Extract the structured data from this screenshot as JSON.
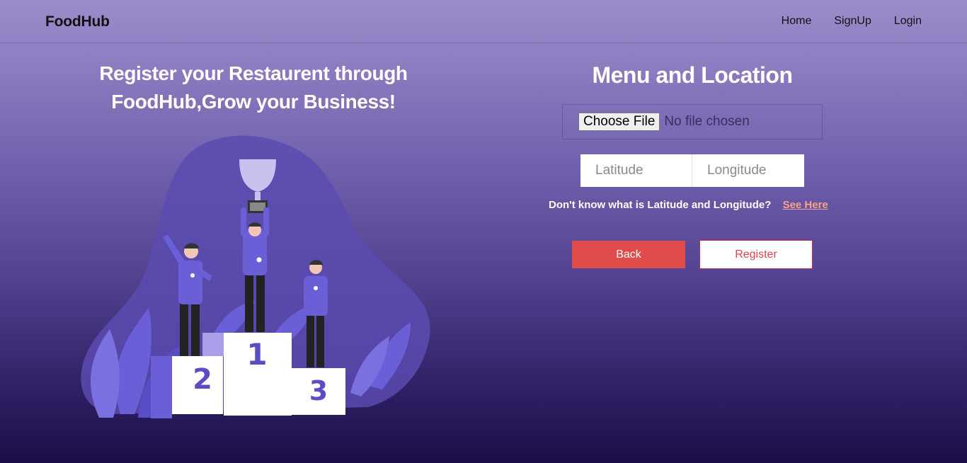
{
  "nav": {
    "brand": "FoodHub",
    "links": [
      "Home",
      "SignUp",
      "Login"
    ]
  },
  "hero": {
    "heading_line1": "Register your Restaurent through",
    "heading_line2": "FoodHub,Grow your Business!",
    "podium": {
      "first": "1",
      "second": "2",
      "third": "3"
    }
  },
  "form": {
    "title": "Menu and Location",
    "file_button": "Choose File",
    "file_status": "No file chosen",
    "latitude_placeholder": "Latitude",
    "longitude_placeholder": "Longitude",
    "help_text": "Don't know what is Latitude and Longitude?",
    "help_link": "See Here",
    "back_label": "Back",
    "register_label": "Register"
  },
  "colors": {
    "back_button": "#e04b4b",
    "register_border": "#c9304b",
    "help_link": "#f6a38a",
    "illustration_accent": "#6a5fd6"
  },
  "icons": [
    "trophy-icon",
    "medal-icon"
  ]
}
